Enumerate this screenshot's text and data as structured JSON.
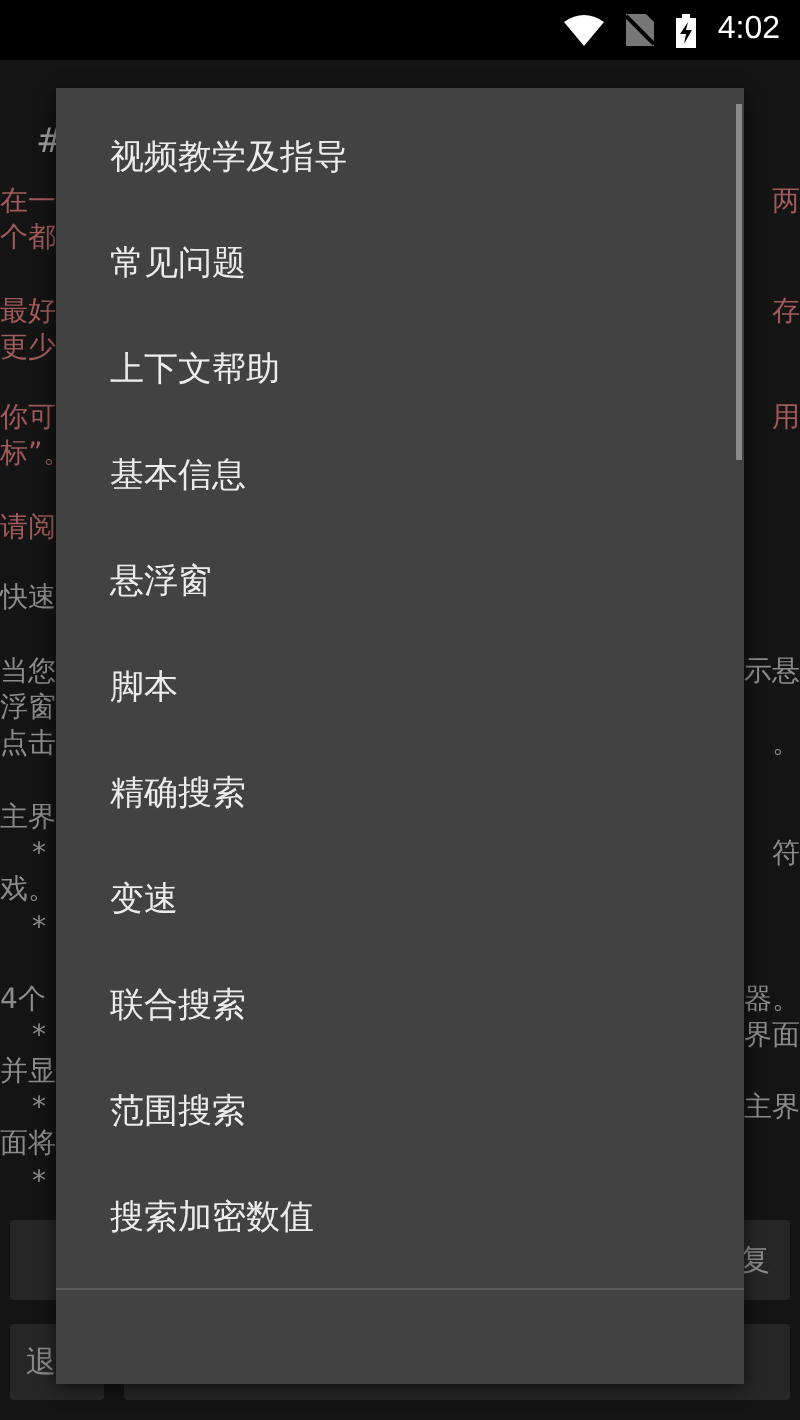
{
  "status_bar": {
    "time": "4:02"
  },
  "background": {
    "left": [
      {
        "text": "#",
        "color": "#9e9e9e"
      },
      {
        "text": "在一",
        "color": "#a05a5a"
      },
      {
        "text": "个都",
        "color": "#a05a5a"
      },
      {
        "text": "最好",
        "color": "#a05a5a"
      },
      {
        "text": "更少",
        "color": "#a05a5a"
      },
      {
        "text": "你可",
        "color": "#a05a5a"
      },
      {
        "text": "标”。",
        "color": "#a05a5a"
      },
      {
        "text": "请阅",
        "color": "#a05a5a"
      },
      {
        "text": "快速",
        "color": "#8c8c8c"
      },
      {
        "text": "当您",
        "color": "#8c8c8c"
      },
      {
        "text": "浮窗",
        "color": "#8c8c8c"
      },
      {
        "text": "点击",
        "color": "#8c8c8c"
      },
      {
        "text": "主界",
        "color": "#8c8c8c"
      },
      {
        "text": "*",
        "color": "#8c8c8c"
      },
      {
        "text": "戏。",
        "color": "#8c8c8c"
      },
      {
        "text": "*",
        "color": "#8c8c8c"
      },
      {
        "text": "4个",
        "color": "#8c8c8c"
      },
      {
        "text": "*",
        "color": "#8c8c8c"
      },
      {
        "text": "并显",
        "color": "#8c8c8c"
      },
      {
        "text": "*",
        "color": "#8c8c8c"
      },
      {
        "text": "面将",
        "color": "#8c8c8c"
      },
      {
        "text": "*",
        "color": "#8c8c8c"
      }
    ],
    "right": [
      {
        "text": "两",
        "color": "#a05a5a"
      },
      {
        "text": "存",
        "color": "#a05a5a"
      },
      {
        "text": "用",
        "color": "#a05a5a"
      },
      {
        "text": "示悬",
        "color": "#8c8c8c"
      },
      {
        "text": "。",
        "color": "#8c8c8c"
      },
      {
        "text": "符",
        "color": "#8c8c8c"
      },
      {
        "text": "器。",
        "color": "#8c8c8c"
      },
      {
        "text": "界面",
        "color": "#8c8c8c"
      },
      {
        "text": "主界",
        "color": "#8c8c8c"
      }
    ],
    "buttons": [
      "复",
      "退"
    ]
  },
  "menu": {
    "items": [
      "视频教学及指导",
      "常见问题",
      "上下文帮助",
      "基本信息",
      "悬浮窗",
      "脚本",
      "精确搜索",
      "变速",
      "联合搜索",
      "范围搜索",
      "搜索加密数值"
    ]
  }
}
